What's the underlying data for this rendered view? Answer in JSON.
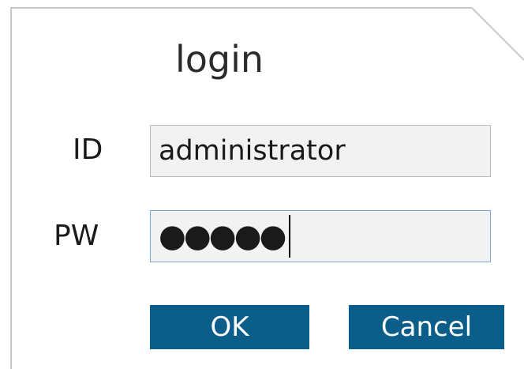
{
  "dialog": {
    "title": "login",
    "id_label": "ID",
    "pw_label": "PW",
    "id_value": "administrator",
    "pw_masked": "●●●●●",
    "ok_label": "OK",
    "cancel_label": "Cancel"
  },
  "colors": {
    "button_bg": "#0c5e8a",
    "field_bg": "#f2f2f2",
    "focus_border": "#7aa7d8"
  }
}
